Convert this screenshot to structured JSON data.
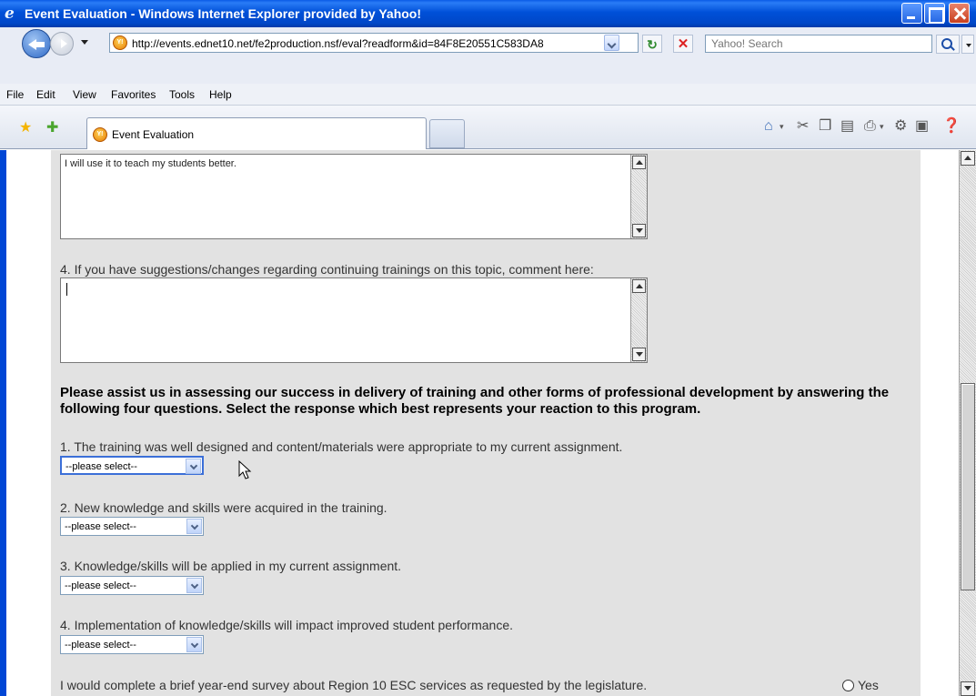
{
  "window": {
    "title": "Event Evaluation - Windows Internet Explorer provided by Yahoo!",
    "icon": "ie-icon"
  },
  "address": {
    "url": "http://events.ednet10.net/fe2production.nsf/eval?readform&id=84F8E20551C583DA8",
    "search_placeholder": "Yahoo! Search"
  },
  "menu": {
    "items": [
      "File",
      "Edit",
      "View",
      "Favorites",
      "Tools",
      "Help"
    ]
  },
  "tabs": {
    "active_label": "Event Evaluation"
  },
  "form": {
    "q3_answer": "I will use it to teach my students better.",
    "q4_label": "4. If you have suggestions/changes regarding continuing trainings on this topic, comment here:",
    "intro": "Please assist us in assessing our success in delivery of training and other forms of professional development by answering the following four questions. Select the response which best represents your reaction to this program.",
    "ratings": [
      {
        "label": "1. The training was well designed and content/materials were appropriate to my current assignment.",
        "value": "--please select--"
      },
      {
        "label": "2. New knowledge and skills were acquired in the training.",
        "value": "--please select--"
      },
      {
        "label": "3. Knowledge/skills will be applied in my current assignment.",
        "value": "--please select--"
      },
      {
        "label": "4. Implementation of knowledge/skills will impact improved student performance.",
        "value": "--please select--"
      }
    ],
    "survey_question": "I would complete a brief year-end survey about Region 10 ESC services as requested by the legislature.",
    "survey_yes": "Yes"
  },
  "colors": {
    "titlebar": "#0050d8",
    "page_bg": "#e2e2e2"
  }
}
